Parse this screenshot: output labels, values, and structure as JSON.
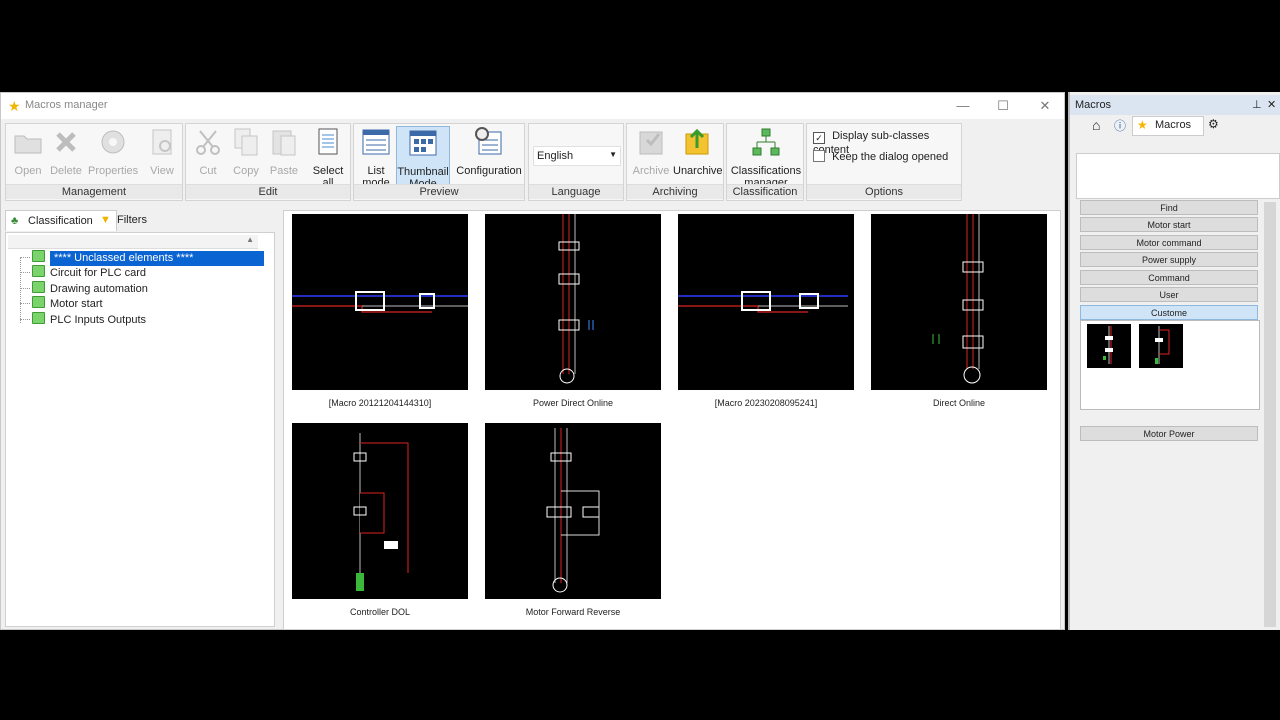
{
  "window": {
    "title": "Macros manager",
    "controls": {
      "minimize": "—",
      "maximize": "☐",
      "close": "✕"
    }
  },
  "ribbon": {
    "management": {
      "label": "Management",
      "open": "Open",
      "delete": "Delete",
      "properties": "Properties",
      "view": "View"
    },
    "edit": {
      "label": "Edit",
      "cut": "Cut",
      "copy": "Copy",
      "paste": "Paste",
      "select_all_1": "Select",
      "select_all_2": "all"
    },
    "preview": {
      "label": "Preview",
      "list_1": "List",
      "list_2": "mode",
      "thumb_1": "Thumbnail",
      "thumb_2": "Mode",
      "configuration": "Configuration"
    },
    "language": {
      "label": "Language",
      "selected": "English"
    },
    "archiving": {
      "label": "Archiving",
      "archive": "Archive",
      "unarchive": "Unarchive"
    },
    "classification": {
      "label": "Classification",
      "manager_1": "Classifications",
      "manager_2": "manager"
    },
    "options": {
      "label": "Options",
      "subclasses": "Display sub-classes content",
      "keep_open": "Keep the dialog opened"
    }
  },
  "tabs": {
    "classification": "Classification",
    "filters": "Filters"
  },
  "tree": {
    "items": [
      {
        "label": "**** Unclassed elements ****"
      },
      {
        "label": "Circuit for PLC card"
      },
      {
        "label": "Drawing automation"
      },
      {
        "label": "Motor start"
      },
      {
        "label": "PLC Inputs Outputs"
      }
    ]
  },
  "thumbnails": [
    {
      "caption": "[Macro 20121204144310]"
    },
    {
      "caption": "Power Direct Online"
    },
    {
      "caption": "[Macro 20230208095241]"
    },
    {
      "caption": "Direct Online"
    },
    {
      "caption": "Controller DOL"
    },
    {
      "caption": "Motor Forward Reverse"
    }
  ],
  "panel": {
    "title": "Macros",
    "pin": "⊥",
    "close": "✕",
    "tab_label": "Macros",
    "buttons": [
      "Find",
      "Motor start",
      "Motor command",
      "Power supply",
      "Command",
      "User",
      "Custome",
      "Motor Power"
    ]
  },
  "colors": {
    "selection": "#0a64d2",
    "accent": "#cfe4f7",
    "leaf": "#7bd36b"
  }
}
